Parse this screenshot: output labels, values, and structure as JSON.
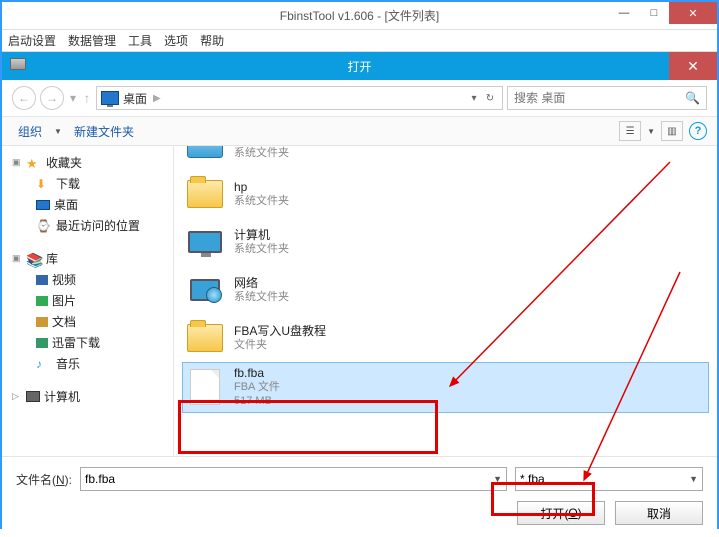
{
  "app": {
    "title": "FbinstTool v1.606 - [文件列表]"
  },
  "menus": [
    "启动设置",
    "数据管理",
    "工具",
    "选项",
    "帮助"
  ],
  "dialog": {
    "title": "打开"
  },
  "breadcrumb": {
    "location": "桌面"
  },
  "search": {
    "placeholder": "搜索 桌面"
  },
  "toolbar": {
    "organize": "组织",
    "newfolder": "新建文件夹"
  },
  "tree": {
    "favorites": "收藏夹",
    "downloads": "下载",
    "desktop": "桌面",
    "recent": "最近访问的位置",
    "libraries": "库",
    "videos": "视频",
    "pictures": "图片",
    "documents": "文档",
    "xunlei": "迅雷下载",
    "music": "音乐",
    "computer": "计算机"
  },
  "files": {
    "truncated_sub": "系统文件夹",
    "hp": {
      "name": "hp",
      "sub": "系统文件夹"
    },
    "computer": {
      "name": "计算机",
      "sub": "系统文件夹"
    },
    "network": {
      "name": "网络",
      "sub": "系统文件夹"
    },
    "fba_folder": {
      "name": "FBA写入U盘教程",
      "sub": "文件夹"
    },
    "fbfba": {
      "name": "fb.fba",
      "type": "FBA 文件",
      "size": "517 MB"
    }
  },
  "bottom": {
    "filename_label_pre": "文件名(",
    "filename_label_key": "N",
    "filename_label_post": "):",
    "filename_value": "fb.fba",
    "filter": "*.fba",
    "open_pre": "打开(",
    "open_key": "O",
    "open_post": ")",
    "cancel": "取消"
  }
}
